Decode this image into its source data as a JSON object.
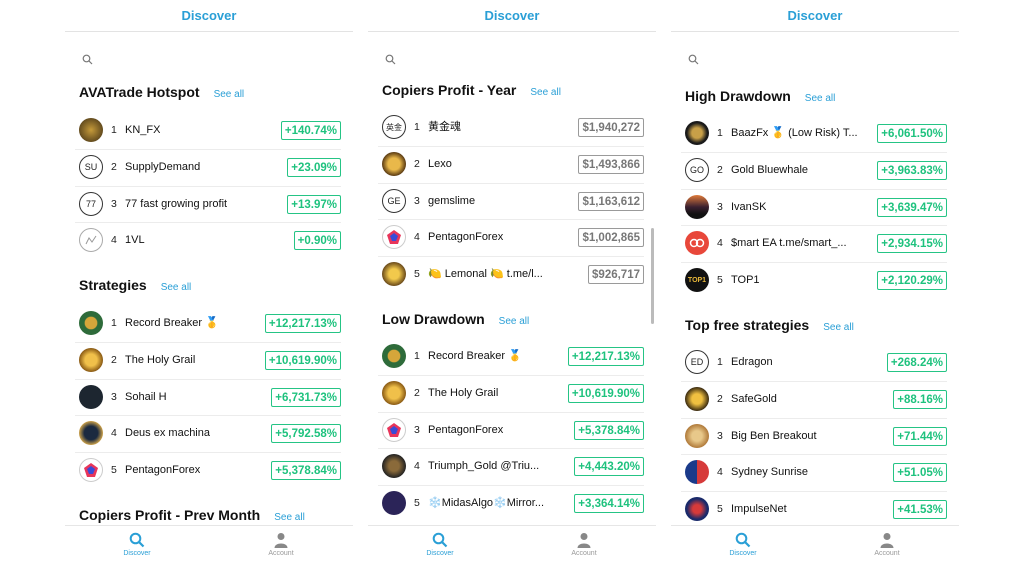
{
  "colors": {
    "accent": "#2a9fd6",
    "positive": "#1ec27e",
    "neutral": "#777777"
  },
  "panels": [
    {
      "header": "Discover",
      "sections": [
        {
          "title": "AVATrade Hotspot",
          "see_all": "See all",
          "rows": [
            {
              "rank": "1",
              "name": "KN_FX",
              "value": "+140.74%",
              "avatar": "image"
            },
            {
              "rank": "2",
              "name": "SupplyDemand",
              "value": "+23.09%",
              "avatar": "SU"
            },
            {
              "rank": "3",
              "name": "77 fast growing profit",
              "value": "+13.97%",
              "avatar": "77"
            },
            {
              "rank": "4",
              "name": "1VL",
              "value": "+0.90%",
              "avatar": "image"
            }
          ]
        },
        {
          "title": "Strategies",
          "see_all": "See all",
          "rows": [
            {
              "rank": "1",
              "name": "Record Breaker 🥇",
              "value": "+12,217.13%",
              "avatar": "image"
            },
            {
              "rank": "2",
              "name": "The Holy Grail",
              "value": "+10,619.90%",
              "avatar": "image"
            },
            {
              "rank": "3",
              "name": "Sohail H",
              "value": "+6,731.73%",
              "avatar": "image"
            },
            {
              "rank": "4",
              "name": "Deus ex machina",
              "value": "+5,792.58%",
              "avatar": "image"
            },
            {
              "rank": "5",
              "name": "PentagonForex",
              "value": "+5,378.84%",
              "avatar": "image"
            }
          ]
        },
        {
          "title": "Copiers Profit - Prev Month",
          "see_all": "See all",
          "rows": []
        }
      ],
      "tabs": {
        "discover": "Discover",
        "account": "Account"
      }
    },
    {
      "header": "Discover",
      "sections": [
        {
          "title": "Copiers Profit - Year",
          "see_all": "See all",
          "rows": [
            {
              "rank": "1",
              "name": "黄金魂",
              "value": "$1,940,272",
              "avatar": "英金"
            },
            {
              "rank": "2",
              "name": "Lexo",
              "value": "$1,493,866",
              "avatar": "image"
            },
            {
              "rank": "3",
              "name": "gemslime",
              "value": "$1,163,612",
              "avatar": "GE"
            },
            {
              "rank": "4",
              "name": "PentagonForex",
              "value": "$1,002,865",
              "avatar": "image"
            },
            {
              "rank": "5",
              "name": "🍋 Lemonal 🍋 t.me/l...",
              "value": "$926,717",
              "avatar": "image"
            }
          ]
        },
        {
          "title": "Low Drawdown",
          "see_all": "See all",
          "rows": [
            {
              "rank": "1",
              "name": "Record Breaker 🥇",
              "value": "+12,217.13%",
              "avatar": "image"
            },
            {
              "rank": "2",
              "name": "The Holy Grail",
              "value": "+10,619.90%",
              "avatar": "image"
            },
            {
              "rank": "3",
              "name": "PentagonForex",
              "value": "+5,378.84%",
              "avatar": "image"
            },
            {
              "rank": "4",
              "name": "Triumph_Gold @Triu...",
              "value": "+4,443.20%",
              "avatar": "image"
            },
            {
              "rank": "5",
              "name": "❄️MidasAlgo❄️Mirror...",
              "value": "+3,364.14%",
              "avatar": "image"
            }
          ]
        }
      ],
      "tabs": {
        "discover": "Discover",
        "account": "Account"
      }
    },
    {
      "header": "Discover",
      "sections": [
        {
          "title": "High Drawdown",
          "see_all": "See all",
          "rows": [
            {
              "rank": "1",
              "name": "BaazFx 🥇 (Low Risk) T...",
              "value": "+6,061.50%",
              "avatar": "image"
            },
            {
              "rank": "2",
              "name": "Gold Bluewhale",
              "value": "+3,963.83%",
              "avatar": "GO"
            },
            {
              "rank": "3",
              "name": "IvanSK",
              "value": "+3,639.47%",
              "avatar": "image"
            },
            {
              "rank": "4",
              "name": "$mart EA t.me/smart_...",
              "value": "+2,934.15%",
              "avatar": "image"
            },
            {
              "rank": "5",
              "name": "TOP1",
              "value": "+2,120.29%",
              "avatar": "image"
            }
          ]
        },
        {
          "title": "Top free strategies",
          "see_all": "See all",
          "rows": [
            {
              "rank": "1",
              "name": "Edragon",
              "value": "+268.24%",
              "avatar": "ED"
            },
            {
              "rank": "2",
              "name": "SafeGold",
              "value": "+88.16%",
              "avatar": "image"
            },
            {
              "rank": "3",
              "name": "Big Ben Breakout",
              "value": "+71.44%",
              "avatar": "image"
            },
            {
              "rank": "4",
              "name": "Sydney Sunrise",
              "value": "+51.05%",
              "avatar": "image"
            },
            {
              "rank": "5",
              "name": "ImpulseNet",
              "value": "+41.53%",
              "avatar": "image"
            }
          ]
        }
      ],
      "tabs": {
        "discover": "Discover",
        "account": "Account"
      }
    }
  ]
}
